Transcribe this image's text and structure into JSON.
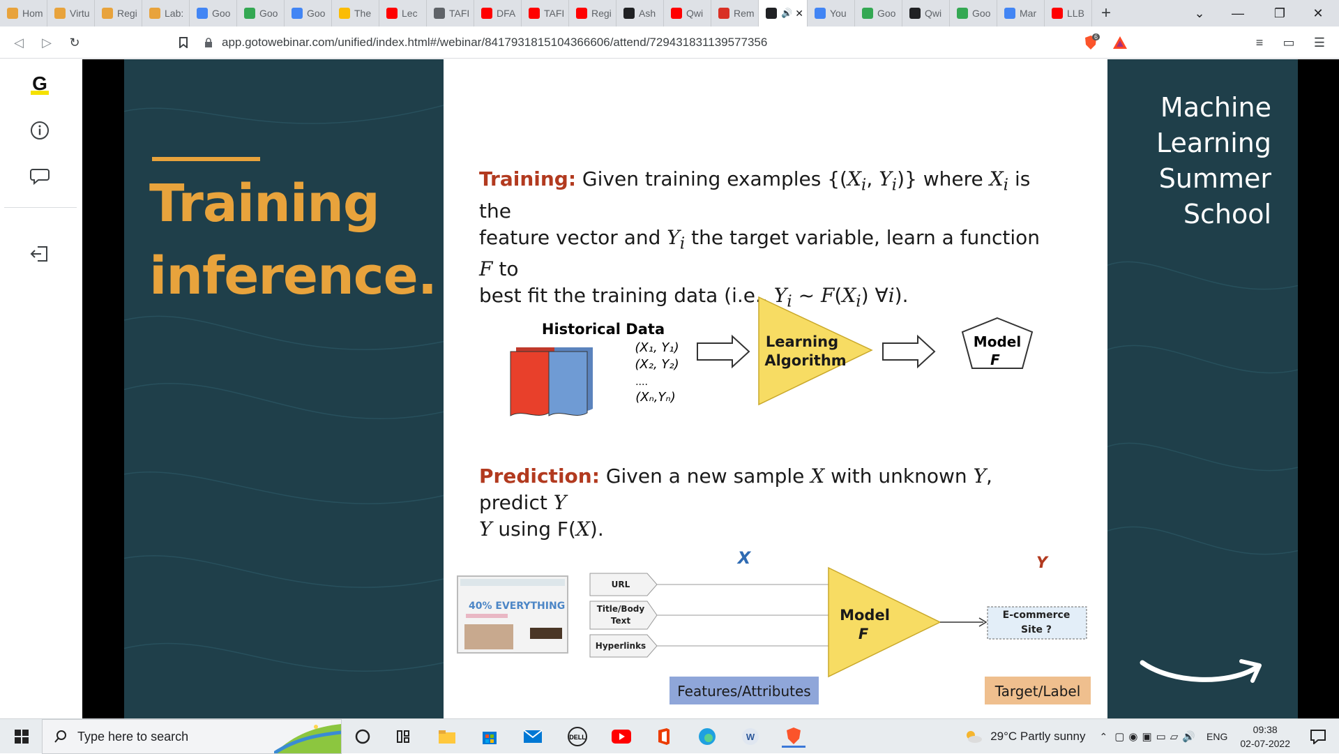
{
  "tabs": [
    {
      "title": "Hom",
      "icon": "cube-icon",
      "color": "#e8a33c"
    },
    {
      "title": "Virtu",
      "icon": "cube-icon",
      "color": "#e8a33c"
    },
    {
      "title": "Regi",
      "icon": "cube-icon",
      "color": "#e8a33c"
    },
    {
      "title": "Lab:",
      "icon": "cube-icon",
      "color": "#e8a33c"
    },
    {
      "title": "Goo",
      "icon": "google-icon",
      "color": "#4285f4"
    },
    {
      "title": "Goo",
      "icon": "drive-icon",
      "color": "#34a853"
    },
    {
      "title": "Goo",
      "icon": "google-icon",
      "color": "#4285f4"
    },
    {
      "title": "The",
      "icon": "drive-icon",
      "color": "#fbbc04"
    },
    {
      "title": "Lec",
      "icon": "youtube-icon",
      "color": "#ff0000"
    },
    {
      "title": "TAFI",
      "icon": "globe-icon",
      "color": "#5f6368"
    },
    {
      "title": "DFA",
      "icon": "youtube-icon",
      "color": "#ff0000"
    },
    {
      "title": "TAFI",
      "icon": "youtube-icon",
      "color": "#ff0000"
    },
    {
      "title": "Regi",
      "icon": "youtube-icon",
      "color": "#ff0000"
    },
    {
      "title": "Ash",
      "icon": "calendar-icon",
      "color": "#202124"
    },
    {
      "title": "Qwi",
      "icon": "youtube-icon",
      "color": "#ff0000"
    },
    {
      "title": "Rem",
      "icon": "gmail-icon",
      "color": "#d93025"
    },
    {
      "title": "",
      "icon": "gotowebinar-icon",
      "color": "#202124",
      "active": true
    },
    {
      "title": "You",
      "icon": "google-icon",
      "color": "#4285f4"
    },
    {
      "title": "Goo",
      "icon": "drive-icon",
      "color": "#34a853"
    },
    {
      "title": "Qwi",
      "icon": "plus-square-icon",
      "color": "#202124"
    },
    {
      "title": "Goo",
      "icon": "drive-icon",
      "color": "#34a853"
    },
    {
      "title": "Mar",
      "icon": "google-icon",
      "color": "#4285f4"
    },
    {
      "title": "LLB",
      "icon": "youtube-icon",
      "color": "#ff0000"
    }
  ],
  "address": {
    "url": "app.gotowebinar.com/unified/index.html#/webinar/8417931815104366606/attend/729431831139577356",
    "brave_badge": "6"
  },
  "slide": {
    "title_line1": "Training",
    "title_line2": "inference.",
    "brand_lines": [
      "Machine",
      "Learning",
      "Summer",
      "School"
    ],
    "training_label": "Training:",
    "training_text1": " Given training examples {(",
    "training_text2": "feature vector and ",
    "training_text3": "best fit the training data (i.e., ",
    "prediction_label": "Prediction:",
    "prediction_text1": " Given a new sample ",
    "prediction_text2": " using F(",
    "historical_data": "Historical Data",
    "pairs": [
      "(X₁, Y₁)",
      "(X₂, Y₂)",
      "....",
      "(Xₙ,Yₙ)"
    ],
    "learning_algorithm": [
      "Learning",
      "Algorithm"
    ],
    "model_f": [
      "Model",
      "F"
    ],
    "feature_x": "X",
    "target_y": "Y",
    "features": [
      "URL",
      "Title/Body\nText",
      "Hyperlinks"
    ],
    "ecommerce": [
      "E-commerce",
      "Site ?"
    ],
    "features_attributes": "Features/Attributes",
    "target_label": "Target/Label",
    "promo_text": "40% EVERYTHING"
  },
  "taskbar": {
    "search_placeholder": "Type here to search",
    "weather": "29°C  Partly sunny",
    "lang": "ENG",
    "time": "09:38",
    "date": "02-07-2022"
  }
}
